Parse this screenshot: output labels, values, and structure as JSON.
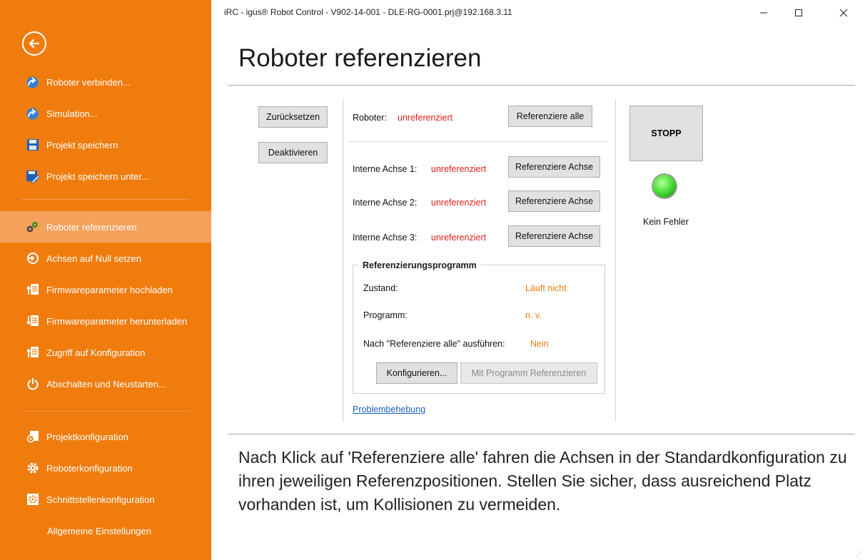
{
  "window": {
    "title": "iRC - igus® Robot Control - V902-14-001 - DLE-RG-0001.prj@192.168.3.11"
  },
  "sidebar": {
    "items": [
      {
        "label": "Roboter verbinden...",
        "icon": "connect-arrow-icon"
      },
      {
        "label": "Simulation...",
        "icon": "connect-arrow-icon"
      },
      {
        "label": "Projekt speichern",
        "icon": "floppy-disk-icon"
      },
      {
        "label": "Projekt speichern unter...",
        "icon": "save-as-icon"
      },
      {
        "label": "Roboter referenzieren",
        "icon": "gears-icon",
        "active": true
      },
      {
        "label": "Achsen auf Null setzen",
        "icon": "zero-axis-icon"
      },
      {
        "label": "Firmwareparameter hochladen",
        "icon": "upload-document-icon"
      },
      {
        "label": "Firmwareparameter herunterladen",
        "icon": "download-document-icon"
      },
      {
        "label": "Zugriff auf Konfiguration",
        "icon": "document-access-icon"
      },
      {
        "label": "Abschalten und Neustarten...",
        "icon": "power-icon"
      },
      {
        "label": "Projektkonfiguration",
        "icon": "project-config-icon"
      },
      {
        "label": "Roboterkonfiguration",
        "icon": "gear-icon"
      },
      {
        "label": "Schnittstellenkonfiguration",
        "icon": "interface-config-icon"
      },
      {
        "label": "Allgemeine Einstellungen",
        "icon": ""
      }
    ]
  },
  "main": {
    "title": "Roboter referenzieren",
    "buttons": {
      "reset": "Zurücksetzen",
      "deactivate": "Deaktivieren",
      "reference_all": "Referenziere alle",
      "reference_axis": "Referenziere Achse",
      "configure": "Konfigurieren...",
      "program_reference": "Mit Programm Referenzieren",
      "stop": "STOPP"
    },
    "robot": {
      "label": "Roboter:",
      "status": "unreferenziert"
    },
    "axes": [
      {
        "label": "Interne Achse 1:",
        "status": "unreferenziert"
      },
      {
        "label": "Interne Achse 2:",
        "status": "unreferenziert"
      },
      {
        "label": "Interne Achse 3:",
        "status": "unreferenziert"
      }
    ],
    "program": {
      "group_title": "Referenzierungsprogramm",
      "state_label": "Zustand:",
      "state_value": "Läuft nicht",
      "program_label": "Programm:",
      "program_value": "n. v.",
      "after_label": "Nach \"Referenziere alle\" ausführen:",
      "after_value": "Nein"
    },
    "error_status": "Kein Fehler",
    "led_color": "#4fe13a",
    "troubleshooting_link": "Problembehebung",
    "info_text": "Nach Klick auf 'Referenziere alle' fahren die Achsen in der Standardkonfiguration zu ihren jeweiligen Referenzpositionen. Stellen Sie sicher, dass ausreichend Platz vorhanden ist, um Kollisionen zu vermeiden."
  },
  "colors": {
    "sidebar_bg": "#f07c0e",
    "sidebar_active": "#f4a15b",
    "status_red": "#e0201c",
    "status_orange": "#f07c0e",
    "link": "#1a5fc7"
  }
}
